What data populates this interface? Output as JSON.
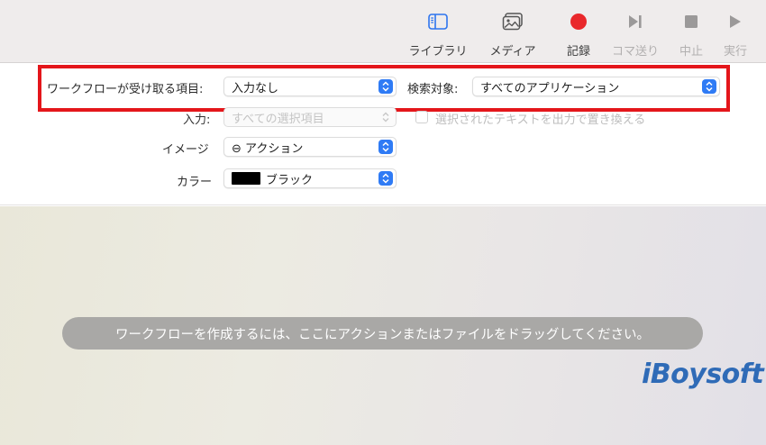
{
  "toolbar": {
    "items": [
      {
        "label": "ライブラリ",
        "icon": "sidebar-icon",
        "enabled": true
      },
      {
        "label": "メディア",
        "icon": "photo-gallery-icon",
        "enabled": true
      },
      {
        "label": "記録",
        "icon": "record-icon",
        "enabled": true
      },
      {
        "label": "コマ送り",
        "icon": "step-forward-icon",
        "enabled": false
      },
      {
        "label": "中止",
        "icon": "stop-icon",
        "enabled": false
      },
      {
        "label": "実行",
        "icon": "play-icon",
        "enabled": false
      }
    ],
    "record_color": "#e9282b"
  },
  "workflow": {
    "receives_label": "ワークフローが受け取る項目:",
    "receives_value": "入力なし",
    "search_label": "検索対象:",
    "search_value": "すべてのアプリケーション",
    "input_label": "入力:",
    "input_value": "すべての選択項目",
    "replace_label": "選択されたテキストを出力で置き換える",
    "replace_checked": false,
    "image_label": "イメージ",
    "image_value": "⊖ アクション",
    "color_label": "カラー",
    "color_value": "ブラック",
    "color_swatch": "#000000"
  },
  "drop_area": {
    "hint": "ワークフローを作成するには、ここにアクションまたはファイルをドラッグしてください。"
  },
  "watermark": {
    "text": "iBoysoft"
  },
  "colors": {
    "accent": "#2f7bf5",
    "highlight_border": "#e4161b"
  }
}
